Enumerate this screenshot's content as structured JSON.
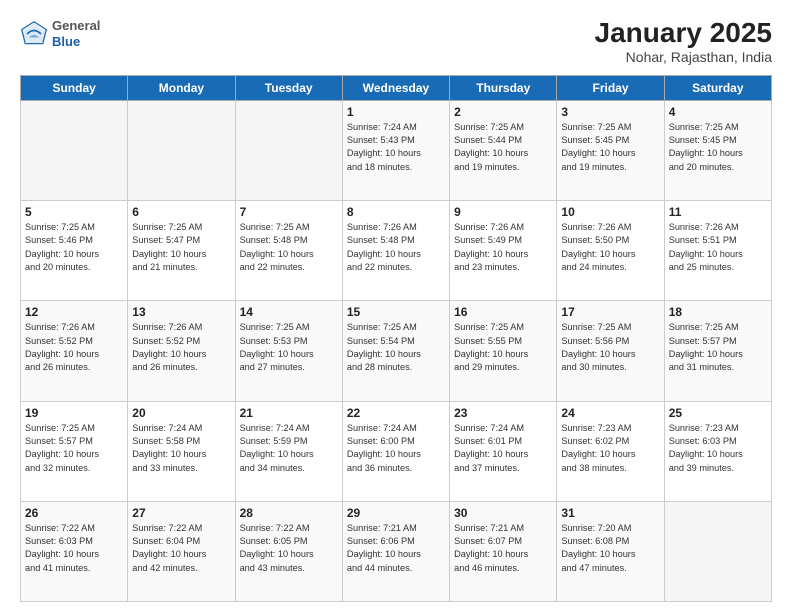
{
  "header": {
    "logo": {
      "general": "General",
      "blue": "Blue"
    },
    "title": "January 2025",
    "subtitle": "Nohar, Rajasthan, India"
  },
  "days_of_week": [
    "Sunday",
    "Monday",
    "Tuesday",
    "Wednesday",
    "Thursday",
    "Friday",
    "Saturday"
  ],
  "weeks": [
    [
      {
        "day": "",
        "info": ""
      },
      {
        "day": "",
        "info": ""
      },
      {
        "day": "",
        "info": ""
      },
      {
        "day": "1",
        "info": "Sunrise: 7:24 AM\nSunset: 5:43 PM\nDaylight: 10 hours\nand 18 minutes."
      },
      {
        "day": "2",
        "info": "Sunrise: 7:25 AM\nSunset: 5:44 PM\nDaylight: 10 hours\nand 19 minutes."
      },
      {
        "day": "3",
        "info": "Sunrise: 7:25 AM\nSunset: 5:45 PM\nDaylight: 10 hours\nand 19 minutes."
      },
      {
        "day": "4",
        "info": "Sunrise: 7:25 AM\nSunset: 5:45 PM\nDaylight: 10 hours\nand 20 minutes."
      }
    ],
    [
      {
        "day": "5",
        "info": "Sunrise: 7:25 AM\nSunset: 5:46 PM\nDaylight: 10 hours\nand 20 minutes."
      },
      {
        "day": "6",
        "info": "Sunrise: 7:25 AM\nSunset: 5:47 PM\nDaylight: 10 hours\nand 21 minutes."
      },
      {
        "day": "7",
        "info": "Sunrise: 7:25 AM\nSunset: 5:48 PM\nDaylight: 10 hours\nand 22 minutes."
      },
      {
        "day": "8",
        "info": "Sunrise: 7:26 AM\nSunset: 5:48 PM\nDaylight: 10 hours\nand 22 minutes."
      },
      {
        "day": "9",
        "info": "Sunrise: 7:26 AM\nSunset: 5:49 PM\nDaylight: 10 hours\nand 23 minutes."
      },
      {
        "day": "10",
        "info": "Sunrise: 7:26 AM\nSunset: 5:50 PM\nDaylight: 10 hours\nand 24 minutes."
      },
      {
        "day": "11",
        "info": "Sunrise: 7:26 AM\nSunset: 5:51 PM\nDaylight: 10 hours\nand 25 minutes."
      }
    ],
    [
      {
        "day": "12",
        "info": "Sunrise: 7:26 AM\nSunset: 5:52 PM\nDaylight: 10 hours\nand 26 minutes."
      },
      {
        "day": "13",
        "info": "Sunrise: 7:26 AM\nSunset: 5:52 PM\nDaylight: 10 hours\nand 26 minutes."
      },
      {
        "day": "14",
        "info": "Sunrise: 7:25 AM\nSunset: 5:53 PM\nDaylight: 10 hours\nand 27 minutes."
      },
      {
        "day": "15",
        "info": "Sunrise: 7:25 AM\nSunset: 5:54 PM\nDaylight: 10 hours\nand 28 minutes."
      },
      {
        "day": "16",
        "info": "Sunrise: 7:25 AM\nSunset: 5:55 PM\nDaylight: 10 hours\nand 29 minutes."
      },
      {
        "day": "17",
        "info": "Sunrise: 7:25 AM\nSunset: 5:56 PM\nDaylight: 10 hours\nand 30 minutes."
      },
      {
        "day": "18",
        "info": "Sunrise: 7:25 AM\nSunset: 5:57 PM\nDaylight: 10 hours\nand 31 minutes."
      }
    ],
    [
      {
        "day": "19",
        "info": "Sunrise: 7:25 AM\nSunset: 5:57 PM\nDaylight: 10 hours\nand 32 minutes."
      },
      {
        "day": "20",
        "info": "Sunrise: 7:24 AM\nSunset: 5:58 PM\nDaylight: 10 hours\nand 33 minutes."
      },
      {
        "day": "21",
        "info": "Sunrise: 7:24 AM\nSunset: 5:59 PM\nDaylight: 10 hours\nand 34 minutes."
      },
      {
        "day": "22",
        "info": "Sunrise: 7:24 AM\nSunset: 6:00 PM\nDaylight: 10 hours\nand 36 minutes."
      },
      {
        "day": "23",
        "info": "Sunrise: 7:24 AM\nSunset: 6:01 PM\nDaylight: 10 hours\nand 37 minutes."
      },
      {
        "day": "24",
        "info": "Sunrise: 7:23 AM\nSunset: 6:02 PM\nDaylight: 10 hours\nand 38 minutes."
      },
      {
        "day": "25",
        "info": "Sunrise: 7:23 AM\nSunset: 6:03 PM\nDaylight: 10 hours\nand 39 minutes."
      }
    ],
    [
      {
        "day": "26",
        "info": "Sunrise: 7:22 AM\nSunset: 6:03 PM\nDaylight: 10 hours\nand 41 minutes."
      },
      {
        "day": "27",
        "info": "Sunrise: 7:22 AM\nSunset: 6:04 PM\nDaylight: 10 hours\nand 42 minutes."
      },
      {
        "day": "28",
        "info": "Sunrise: 7:22 AM\nSunset: 6:05 PM\nDaylight: 10 hours\nand 43 minutes."
      },
      {
        "day": "29",
        "info": "Sunrise: 7:21 AM\nSunset: 6:06 PM\nDaylight: 10 hours\nand 44 minutes."
      },
      {
        "day": "30",
        "info": "Sunrise: 7:21 AM\nSunset: 6:07 PM\nDaylight: 10 hours\nand 46 minutes."
      },
      {
        "day": "31",
        "info": "Sunrise: 7:20 AM\nSunset: 6:08 PM\nDaylight: 10 hours\nand 47 minutes."
      },
      {
        "day": "",
        "info": ""
      }
    ]
  ]
}
